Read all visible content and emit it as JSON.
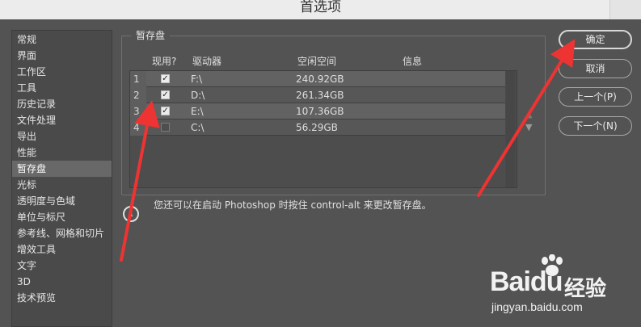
{
  "window": {
    "title": "首选项"
  },
  "sidebar": {
    "items": [
      {
        "label": "常规"
      },
      {
        "label": "界面"
      },
      {
        "label": "工作区"
      },
      {
        "label": "工具"
      },
      {
        "label": "历史记录"
      },
      {
        "label": "文件处理"
      },
      {
        "label": "导出"
      },
      {
        "label": "性能"
      },
      {
        "label": "暂存盘"
      },
      {
        "label": "光标"
      },
      {
        "label": "透明度与色域"
      },
      {
        "label": "单位与标尺"
      },
      {
        "label": "参考线、网格和切片"
      },
      {
        "label": "增效工具"
      },
      {
        "label": "文字"
      },
      {
        "label": "3D"
      },
      {
        "label": "技术预览"
      }
    ],
    "active_index": 8
  },
  "scratch_disks": {
    "group_title": "暂存盘",
    "headers": {
      "use": "现用?",
      "drive": "驱动器",
      "free": "空闲空间",
      "info": "信息"
    },
    "rows": [
      {
        "num": "1",
        "checked": true,
        "drive": "F:\\",
        "free": "240.92GB",
        "info": ""
      },
      {
        "num": "2",
        "checked": true,
        "drive": "D:\\",
        "free": "261.34GB",
        "info": ""
      },
      {
        "num": "3",
        "checked": true,
        "drive": "E:\\",
        "free": "107.36GB",
        "info": ""
      },
      {
        "num": "4",
        "checked": false,
        "drive": "C:\\",
        "free": "56.29GB",
        "info": ""
      }
    ],
    "check_glyph": "✓"
  },
  "info": {
    "icon": "info-icon",
    "icon_glyph": "i",
    "text": "您还可以在启动 Photoshop 时按住 control-alt 来更改暂存盘。"
  },
  "buttons": {
    "ok": "确定",
    "cancel": "取消",
    "prev": "上一个(P)",
    "next": "下一个(N)"
  },
  "watermark": {
    "brand": "Bai",
    "brand_tail": "du",
    "cn": "经验",
    "url": "jingyan.baidu.com"
  },
  "colors": {
    "background": "#535353",
    "annotation_arrow": "#ee3333"
  }
}
